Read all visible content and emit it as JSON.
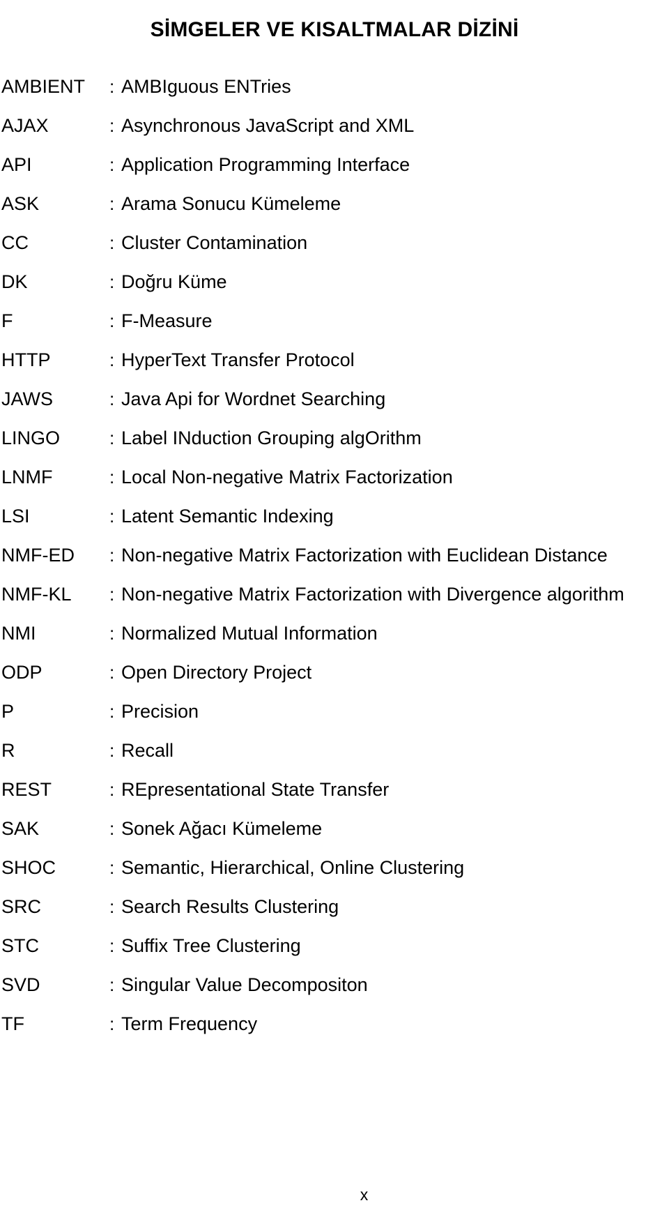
{
  "document": {
    "title": "SİMGELER VE KISALTMALAR DİZİNİ",
    "separator": ":",
    "page_number": "x"
  },
  "entries": [
    {
      "term": "AMBIENT",
      "definition": "AMBIguous ENTries"
    },
    {
      "term": "AJAX",
      "definition": "Asynchronous JavaScript and XML"
    },
    {
      "term": "API",
      "definition": "Application Programming Interface"
    },
    {
      "term": "ASK",
      "definition": "Arama Sonucu Kümeleme"
    },
    {
      "term": "CC",
      "definition": "Cluster Contamination"
    },
    {
      "term": "DK",
      "definition": "Doğru Küme"
    },
    {
      "term": "F",
      "definition": "F-Measure"
    },
    {
      "term": "HTTP",
      "definition": "HyperText Transfer Protocol"
    },
    {
      "term": "JAWS",
      "definition": "Java Api for Wordnet Searching"
    },
    {
      "term": "LINGO",
      "definition": "Label INduction Grouping algOrithm"
    },
    {
      "term": "LNMF",
      "definition": "Local Non-negative Matrix Factorization"
    },
    {
      "term": "LSI",
      "definition": "Latent Semantic Indexing"
    },
    {
      "term": "NMF-ED",
      "definition": "Non-negative Matrix Factorization with Euclidean Distance"
    },
    {
      "term": "NMF-KL",
      "definition": "Non-negative Matrix Factorization with Divergence algorithm"
    },
    {
      "term": "NMI",
      "definition": "Normalized Mutual Information"
    },
    {
      "term": "ODP",
      "definition": "Open Directory Project"
    },
    {
      "term": "P",
      "definition": "Precision"
    },
    {
      "term": "R",
      "definition": "Recall"
    },
    {
      "term": "REST",
      "definition": "REpresentational State Transfer"
    },
    {
      "term": "SAK",
      "definition": "Sonek Ağacı Kümeleme"
    },
    {
      "term": "SHOC",
      "definition": "Semantic, Hierarchical, Online Clustering"
    },
    {
      "term": "SRC",
      "definition": "Search Results Clustering"
    },
    {
      "term": "STC",
      "definition": "Suffix Tree Clustering"
    },
    {
      "term": "SVD",
      "definition": "Singular Value Decompositon"
    },
    {
      "term": "TF",
      "definition": "Term Frequency"
    }
  ]
}
